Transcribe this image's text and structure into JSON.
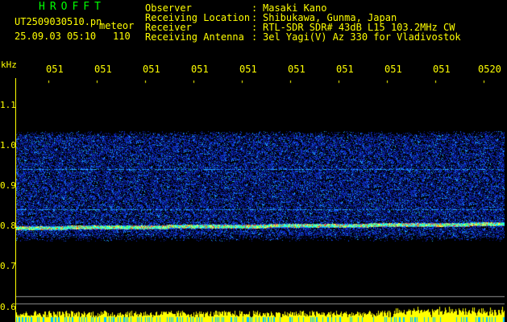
{
  "header": {
    "brand": "HROFFT",
    "filename": "UT2509030510.pn",
    "detector_label": "meteor",
    "datetime": "25.09.03 05:10",
    "count": "110"
  },
  "info": {
    "rows": [
      {
        "label": "Observer",
        "value": "Masaki Kano"
      },
      {
        "label": "Receiving Location",
        "value": "Shibukawa, Gunma, Japan"
      },
      {
        "label": "Receiver",
        "value": "RTL-SDR SDR# 43dB L15 103.2MHz CW"
      },
      {
        "label": "Receiving Antenna",
        "value": "3el Yagi(V) Az 330 for Vladivostok"
      }
    ]
  },
  "axis": {
    "unit": "kHz",
    "y_ticks": [
      "1.1",
      "1.0",
      "0.9",
      "0.8",
      "0.7",
      "0.6"
    ],
    "x_ticks": [
      "051",
      "051",
      "051",
      "051",
      "051",
      "051",
      "051",
      "051",
      "051",
      "0520"
    ]
  },
  "colors": {
    "text": "#ffff00",
    "brand": "#00ff00",
    "background": "#000000",
    "noise_low": "#1030c0",
    "noise_high": "#00ffff",
    "signal": "#ff4020"
  }
}
